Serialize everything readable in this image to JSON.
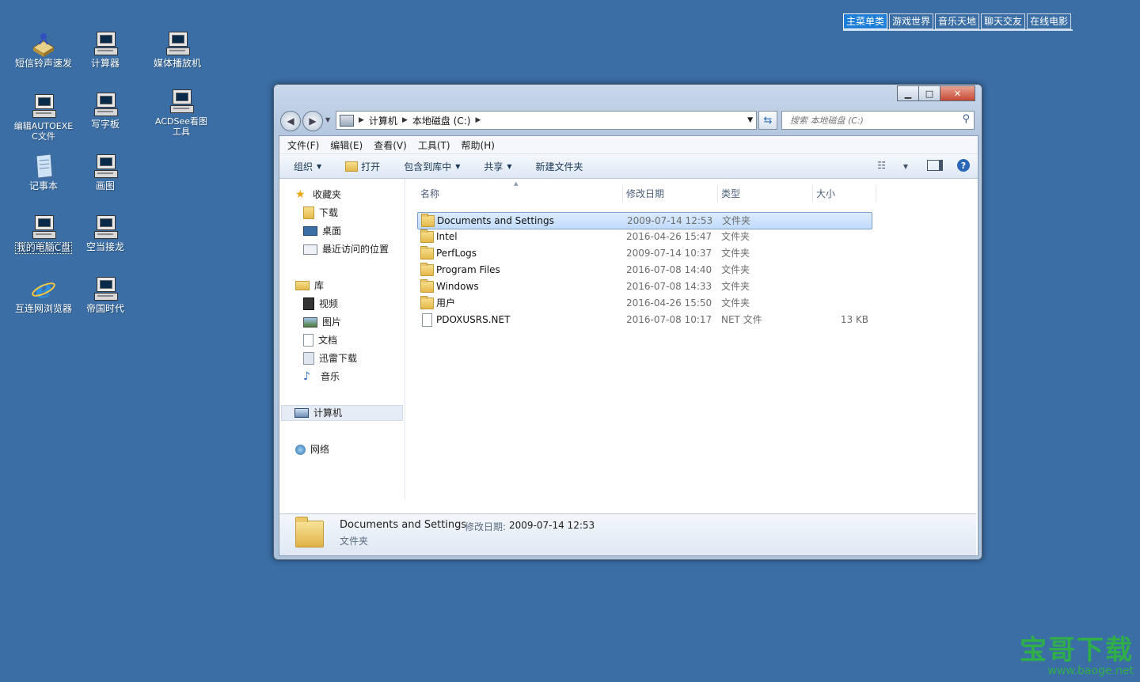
{
  "desktop": {
    "icons": [
      {
        "label": "短信铃声速发",
        "icon": "bell-icon"
      },
      {
        "label": "计算器",
        "icon": "computer-icon"
      },
      {
        "label": "媒体播放机",
        "icon": "computer-icon"
      },
      {
        "label": "编辑AUTOEXEC文件",
        "icon": "computer-icon"
      },
      {
        "label": "写字板",
        "icon": "computer-icon"
      },
      {
        "label": "ACDSee看图工具",
        "icon": "computer-icon"
      },
      {
        "label": "记事本",
        "icon": "notepad-icon"
      },
      {
        "label": "画图",
        "icon": "computer-icon"
      },
      {
        "label": "我的电脑C盘",
        "icon": "computer-icon"
      },
      {
        "label": "空当接龙",
        "icon": "computer-icon"
      },
      {
        "label": "互连网浏览器",
        "icon": "ie-icon"
      },
      {
        "label": "帝国时代",
        "icon": "computer-icon"
      }
    ]
  },
  "topmenu": {
    "items": [
      "主菜单类",
      "游戏世界",
      "音乐天地",
      "聊天交友",
      "在线电影"
    ],
    "active": "主菜单类"
  },
  "window": {
    "address": {
      "seg1": "计算机",
      "seg2": "本地磁盘 (C:)"
    },
    "search": {
      "placeholder": "搜索 本地磁盘 (C:)"
    },
    "menubar": [
      "文件(F)",
      "编辑(E)",
      "查看(V)",
      "工具(T)",
      "帮助(H)"
    ],
    "toolbar": {
      "organize": "组织",
      "open": "打开",
      "include": "包含到库中",
      "share": "共享",
      "newfolder": "新建文件夹"
    },
    "nav": {
      "favorites": "收藏夹",
      "downloads": "下载",
      "desktop": "桌面",
      "recent": "最近访问的位置",
      "libraries": "库",
      "videos": "视频",
      "pictures": "图片",
      "documents": "文档",
      "xunlei": "迅雷下载",
      "music": "音乐",
      "computer": "计算机",
      "network": "网络"
    },
    "columns": {
      "name": "名称",
      "date": "修改日期",
      "type": "类型",
      "size": "大小"
    },
    "files": [
      {
        "name": "Documents and Settings",
        "date": "2009-07-14 12:53",
        "type": "文件夹",
        "size": "",
        "kind": "folder-lock"
      },
      {
        "name": "Intel",
        "date": "2016-04-26 15:47",
        "type": "文件夹",
        "size": "",
        "kind": "folder"
      },
      {
        "name": "PerfLogs",
        "date": "2009-07-14 10:37",
        "type": "文件夹",
        "size": "",
        "kind": "folder"
      },
      {
        "name": "Program Files",
        "date": "2016-07-08 14:40",
        "type": "文件夹",
        "size": "",
        "kind": "folder"
      },
      {
        "name": "Windows",
        "date": "2016-07-08 14:33",
        "type": "文件夹",
        "size": "",
        "kind": "folder"
      },
      {
        "name": "用户",
        "date": "2016-04-26 15:50",
        "type": "文件夹",
        "size": "",
        "kind": "folder"
      },
      {
        "name": "PDOXUSRS.NET",
        "date": "2016-07-08 10:17",
        "type": "NET 文件",
        "size": "13 KB",
        "kind": "file"
      }
    ],
    "details": {
      "name": "Documents and Settings",
      "date_label": "修改日期:",
      "date": "2009-07-14 12:53",
      "type": "文件夹"
    }
  },
  "watermark": {
    "title": "宝哥下载",
    "url": "www.baoge.net",
    "color": "#2fae4a"
  }
}
